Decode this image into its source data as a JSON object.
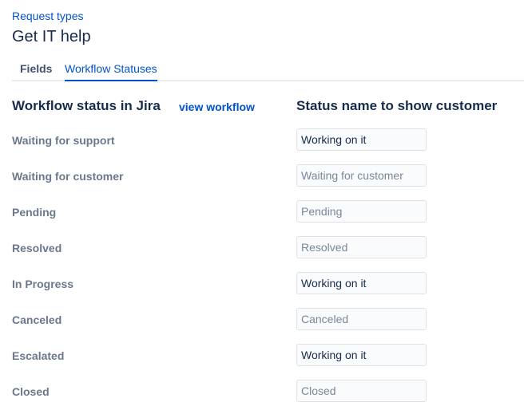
{
  "breadcrumb": "Request types",
  "title": "Get IT help",
  "tabs": [
    {
      "label": "Fields",
      "active": false
    },
    {
      "label": "Workflow Statuses",
      "active": true
    }
  ],
  "columns": {
    "left_heading": "Workflow status in Jira",
    "view_workflow_link": "view workflow",
    "right_heading": "Status name to show customer"
  },
  "statuses": [
    {
      "jira_status": "Waiting for support",
      "value": "Working on it",
      "placeholder": ""
    },
    {
      "jira_status": "Waiting for customer",
      "value": "",
      "placeholder": "Waiting for customer"
    },
    {
      "jira_status": "Pending",
      "value": "",
      "placeholder": "Pending"
    },
    {
      "jira_status": "Resolved",
      "value": "",
      "placeholder": "Resolved"
    },
    {
      "jira_status": "In Progress",
      "value": "Working on it",
      "placeholder": ""
    },
    {
      "jira_status": "Canceled",
      "value": "",
      "placeholder": "Canceled"
    },
    {
      "jira_status": "Escalated",
      "value": "Working on it",
      "placeholder": ""
    },
    {
      "jira_status": "Closed",
      "value": "",
      "placeholder": "Closed"
    }
  ],
  "colors": {
    "link": "#0052cc",
    "label": "#6b778c",
    "text": "#172b4d"
  }
}
